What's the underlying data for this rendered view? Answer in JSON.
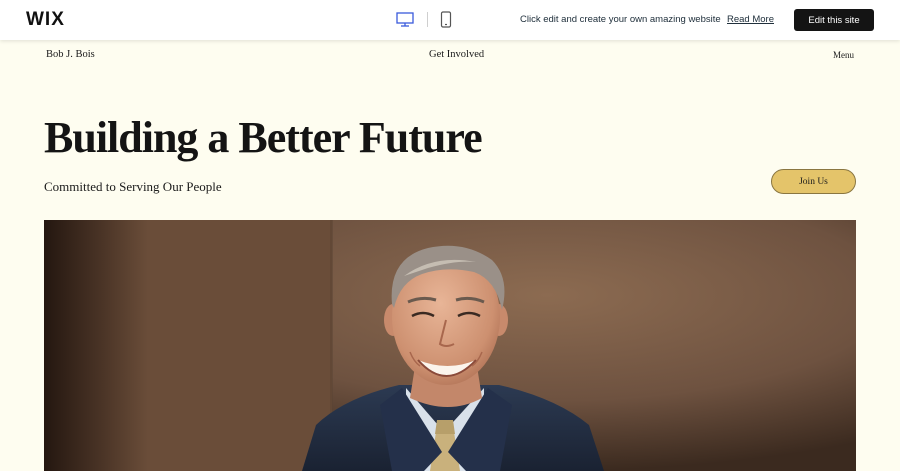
{
  "wixbar": {
    "logo": "WIX",
    "message": "Click edit and create your own amazing website",
    "read_more": "Read More",
    "edit_button": "Edit this site",
    "icons": [
      "desktop-icon",
      "mobile-icon"
    ]
  },
  "site": {
    "name": "Bob J. Bois",
    "nav_get_involved": "Get Involved",
    "nav_menu": "Menu"
  },
  "hero": {
    "title": "Building a Better Future",
    "subtitle": "Committed to Serving Our People",
    "join_button": "Join Us"
  },
  "colors": {
    "background": "#fefdf0",
    "accent": "#e4c46a",
    "edit_button_bg": "#141414"
  }
}
